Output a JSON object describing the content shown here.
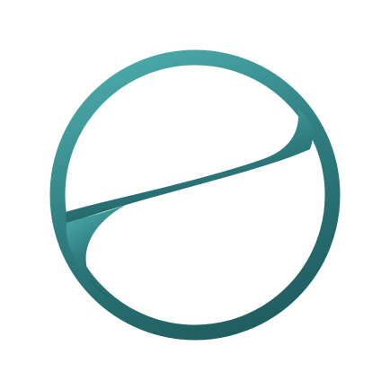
{
  "icon": {
    "name": "circle-swoosh-logo-icon"
  },
  "colors": {
    "background": "#ffffff",
    "gradient_light": "#4aa8a8",
    "gradient_mid": "#2f7d80",
    "gradient_dark": "#1f5d60"
  }
}
